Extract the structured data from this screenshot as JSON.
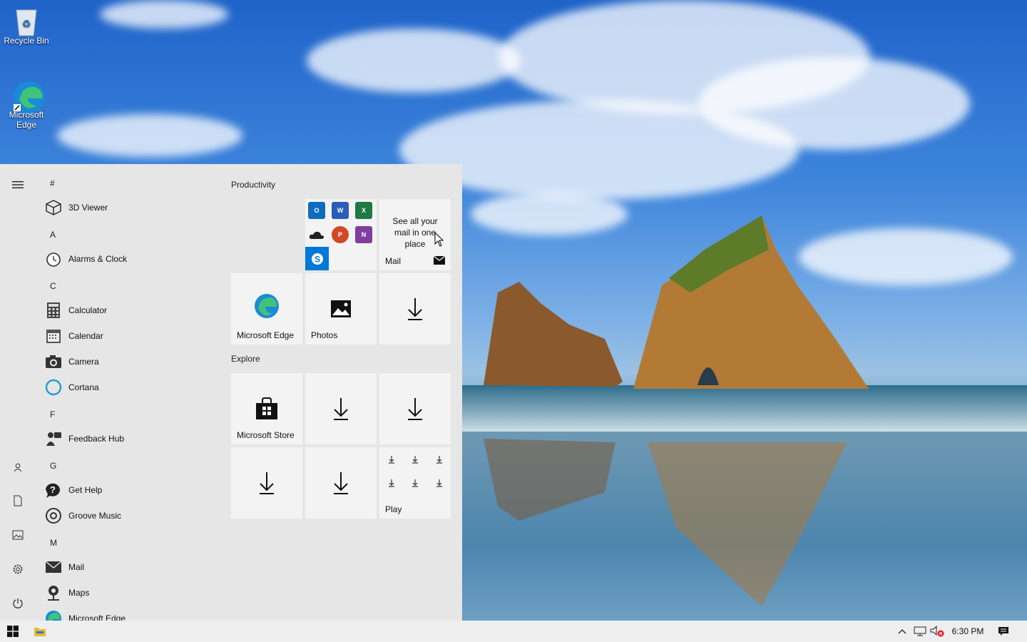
{
  "desktop": {
    "icons": [
      {
        "label": "Recycle Bin"
      },
      {
        "label": "Microsoft Edge"
      }
    ]
  },
  "start_menu": {
    "rail": [
      "hamburger-icon",
      "user-icon",
      "documents-icon",
      "pictures-icon",
      "settings-icon",
      "power-icon"
    ],
    "sections": [
      {
        "letter": "#"
      },
      {
        "letter": "A"
      },
      {
        "letter": "C"
      },
      {
        "letter": "F"
      },
      {
        "letter": "G"
      },
      {
        "letter": "M"
      }
    ],
    "apps": [
      {
        "label": "3D Viewer"
      },
      {
        "label": "Alarms & Clock"
      },
      {
        "label": "Calculator"
      },
      {
        "label": "Calendar"
      },
      {
        "label": "Camera"
      },
      {
        "label": "Cortana"
      },
      {
        "label": "Feedback Hub"
      },
      {
        "label": "Get Help"
      },
      {
        "label": "Groove Music"
      },
      {
        "label": "Mail"
      },
      {
        "label": "Maps"
      },
      {
        "label": "Microsoft Edge"
      }
    ],
    "groups": {
      "productivity": "Productivity",
      "explore": "Explore"
    },
    "tiles": {
      "mail_message": "See all your mail in one place",
      "mail_label": "Mail",
      "edge_label": "Microsoft Edge",
      "photos_label": "Photos",
      "store_label": "Microsoft Store",
      "play_label": "Play"
    }
  },
  "taskbar": {
    "clock": "6:30 PM"
  },
  "colors": {
    "accent": "#0078d7",
    "start_bg": "#e6e6e6",
    "tile_bg": "#f3f3f3"
  }
}
